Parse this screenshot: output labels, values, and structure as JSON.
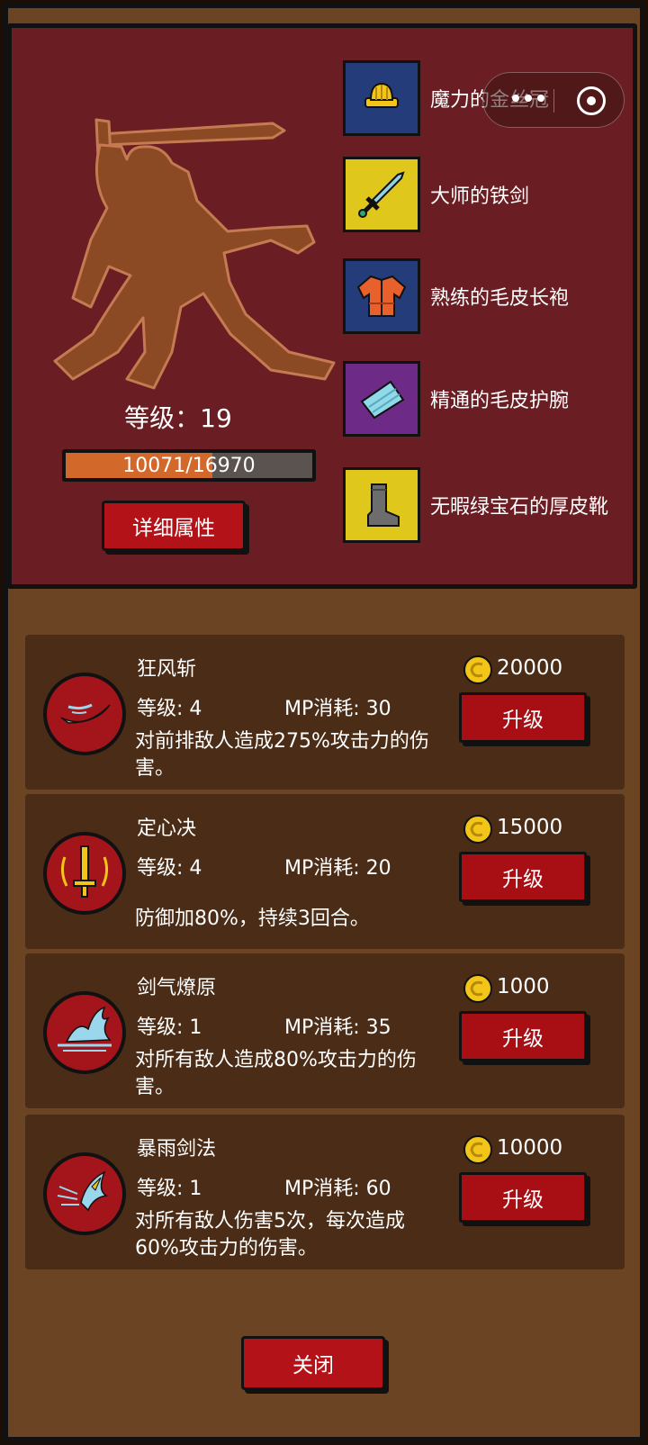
{
  "character": {
    "level_label": "等级：19",
    "level": 19,
    "exp_text": "10071/16970",
    "exp_current": 10071,
    "exp_max": 16970,
    "detail_button": "详细属性"
  },
  "equipment": [
    {
      "name": "魔力的金丝冠",
      "icon": "crown-icon",
      "bg": "#243c7a"
    },
    {
      "name": "大师的铁剑",
      "icon": "sword-icon",
      "bg": "#e0c71b"
    },
    {
      "name": "熟练的毛皮长袍",
      "icon": "robe-icon",
      "bg": "#243c7a"
    },
    {
      "name": "精通的毛皮护腕",
      "icon": "bracer-icon",
      "bg": "#6d2a86"
    },
    {
      "name": "无暇绿宝石的厚皮靴",
      "icon": "boot-icon",
      "bg": "#e0c71b"
    }
  ],
  "skills": [
    {
      "name": "狂风斩",
      "level": "等级: 4",
      "mp": "MP消耗: 30",
      "desc": "对前排敌人造成275%攻击力的伤害。",
      "cost": "20000",
      "button": "升级",
      "icon": "wind-slash-icon"
    },
    {
      "name": "定心决",
      "level": "等级: 4",
      "mp": "MP消耗: 20",
      "desc": "防御加80%，持续3回合。",
      "cost": "15000",
      "button": "升级",
      "icon": "focus-sword-icon"
    },
    {
      "name": "剑气燎原",
      "level": "等级: 1",
      "mp": "MP消耗: 35",
      "desc": "对所有敌人造成80%攻击力的伤害。",
      "cost": "1000",
      "button": "升级",
      "icon": "sword-wave-icon"
    },
    {
      "name": "暴雨剑法",
      "level": "等级: 1",
      "mp": "MP消耗: 60",
      "desc": "对所有敌人伤害5次，每次造成60%攻击力的伤害。",
      "cost": "10000",
      "button": "升级",
      "icon": "storm-blade-icon"
    }
  ],
  "close_button": "关闭"
}
